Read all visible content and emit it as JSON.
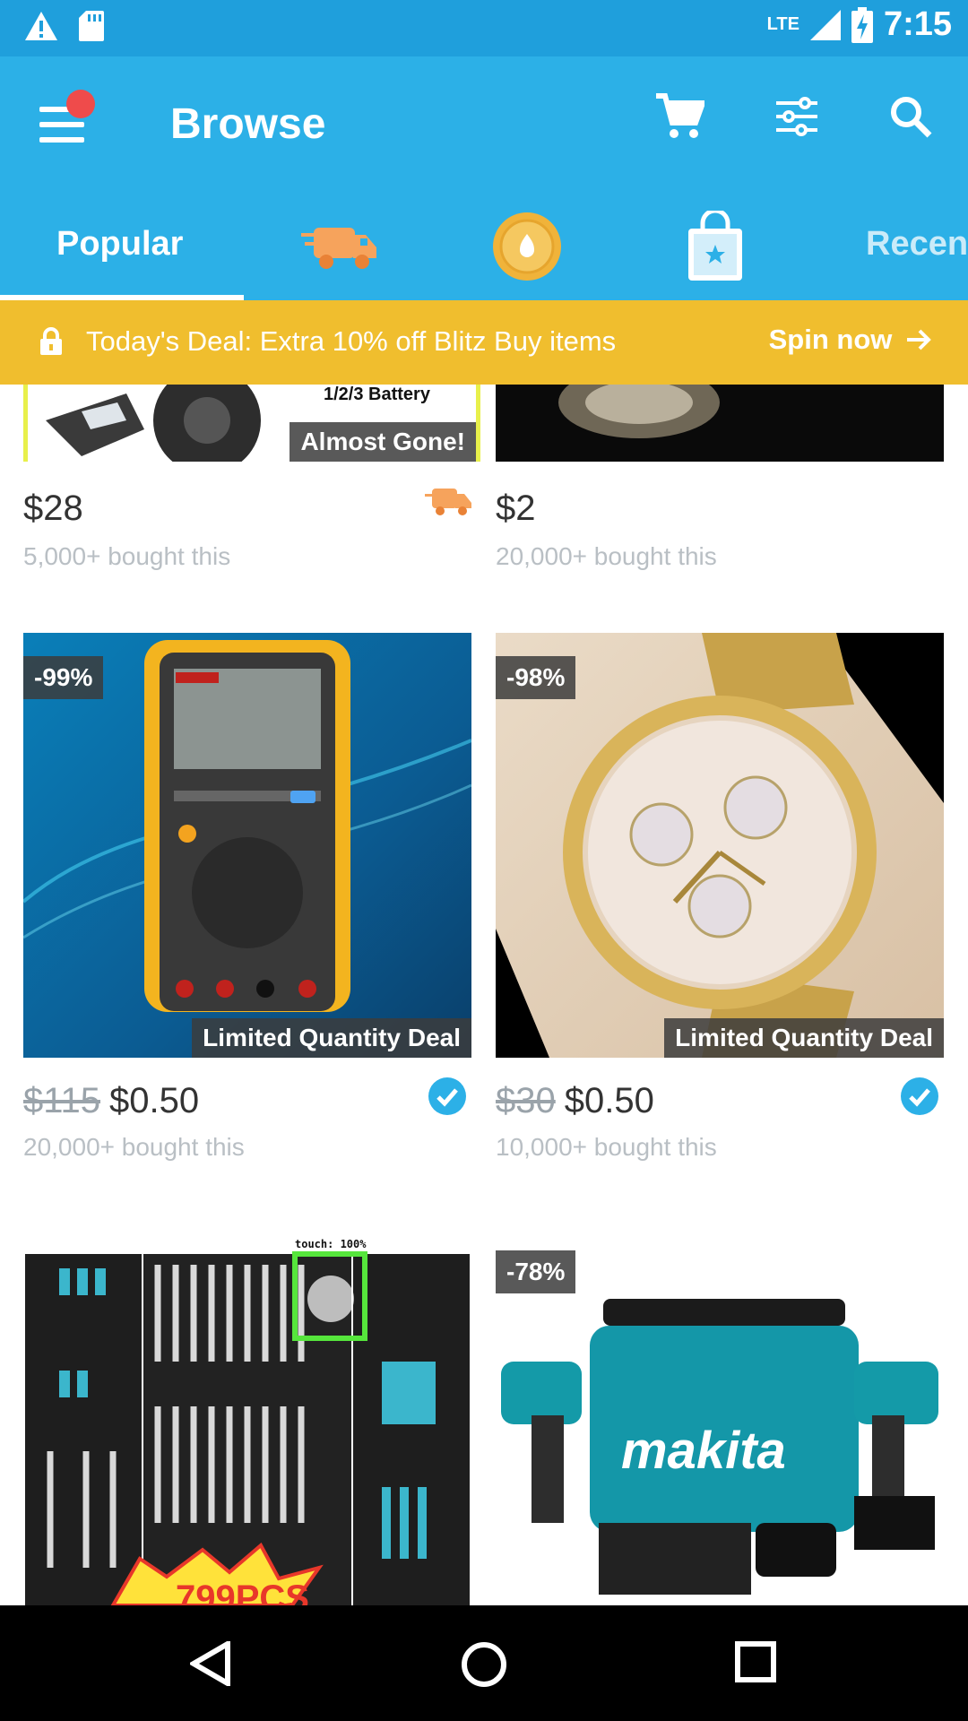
{
  "status_bar": {
    "network": "LTE",
    "time": "7:15"
  },
  "header": {
    "title": "Browse"
  },
  "tabs": [
    {
      "label": "Popular",
      "selected": true
    },
    {
      "icon": "delivery-truck-icon"
    },
    {
      "icon": "wheel-icon"
    },
    {
      "icon": "shopping-bag-star-icon"
    },
    {
      "label": "Recen"
    }
  ],
  "deal_banner": {
    "text": "Today's Deal: Extra 10% off Blitz Buy items",
    "action": "Spin now"
  },
  "products": [
    {
      "image_text": "1/2/3 Battery",
      "overlay": "Almost Gone!",
      "price": "$28",
      "sold": "5,000+ bought this",
      "fast_shipping": true
    },
    {
      "price": "$2",
      "sold": "20,000+ bought this"
    },
    {
      "discount": "-99%",
      "overlay": "Limited Quantity Deal",
      "old_price": "$115",
      "price": "$0.50",
      "sold": "20,000+ bought this",
      "verified": true
    },
    {
      "discount": "-98%",
      "overlay": "Limited Quantity Deal",
      "old_price": "$30",
      "price": "$0.50",
      "sold": "10,000+ bought this",
      "verified": true
    },
    {
      "image_text": "799PCS",
      "touch_label": "touch: 100%"
    },
    {
      "discount": "-78%",
      "image_text": "makita"
    }
  ],
  "colors": {
    "primary": "#2cb0e7",
    "status_bar": "#1f9fdc",
    "banner": "#f0be2e",
    "notification_dot": "#ef4b4b"
  }
}
